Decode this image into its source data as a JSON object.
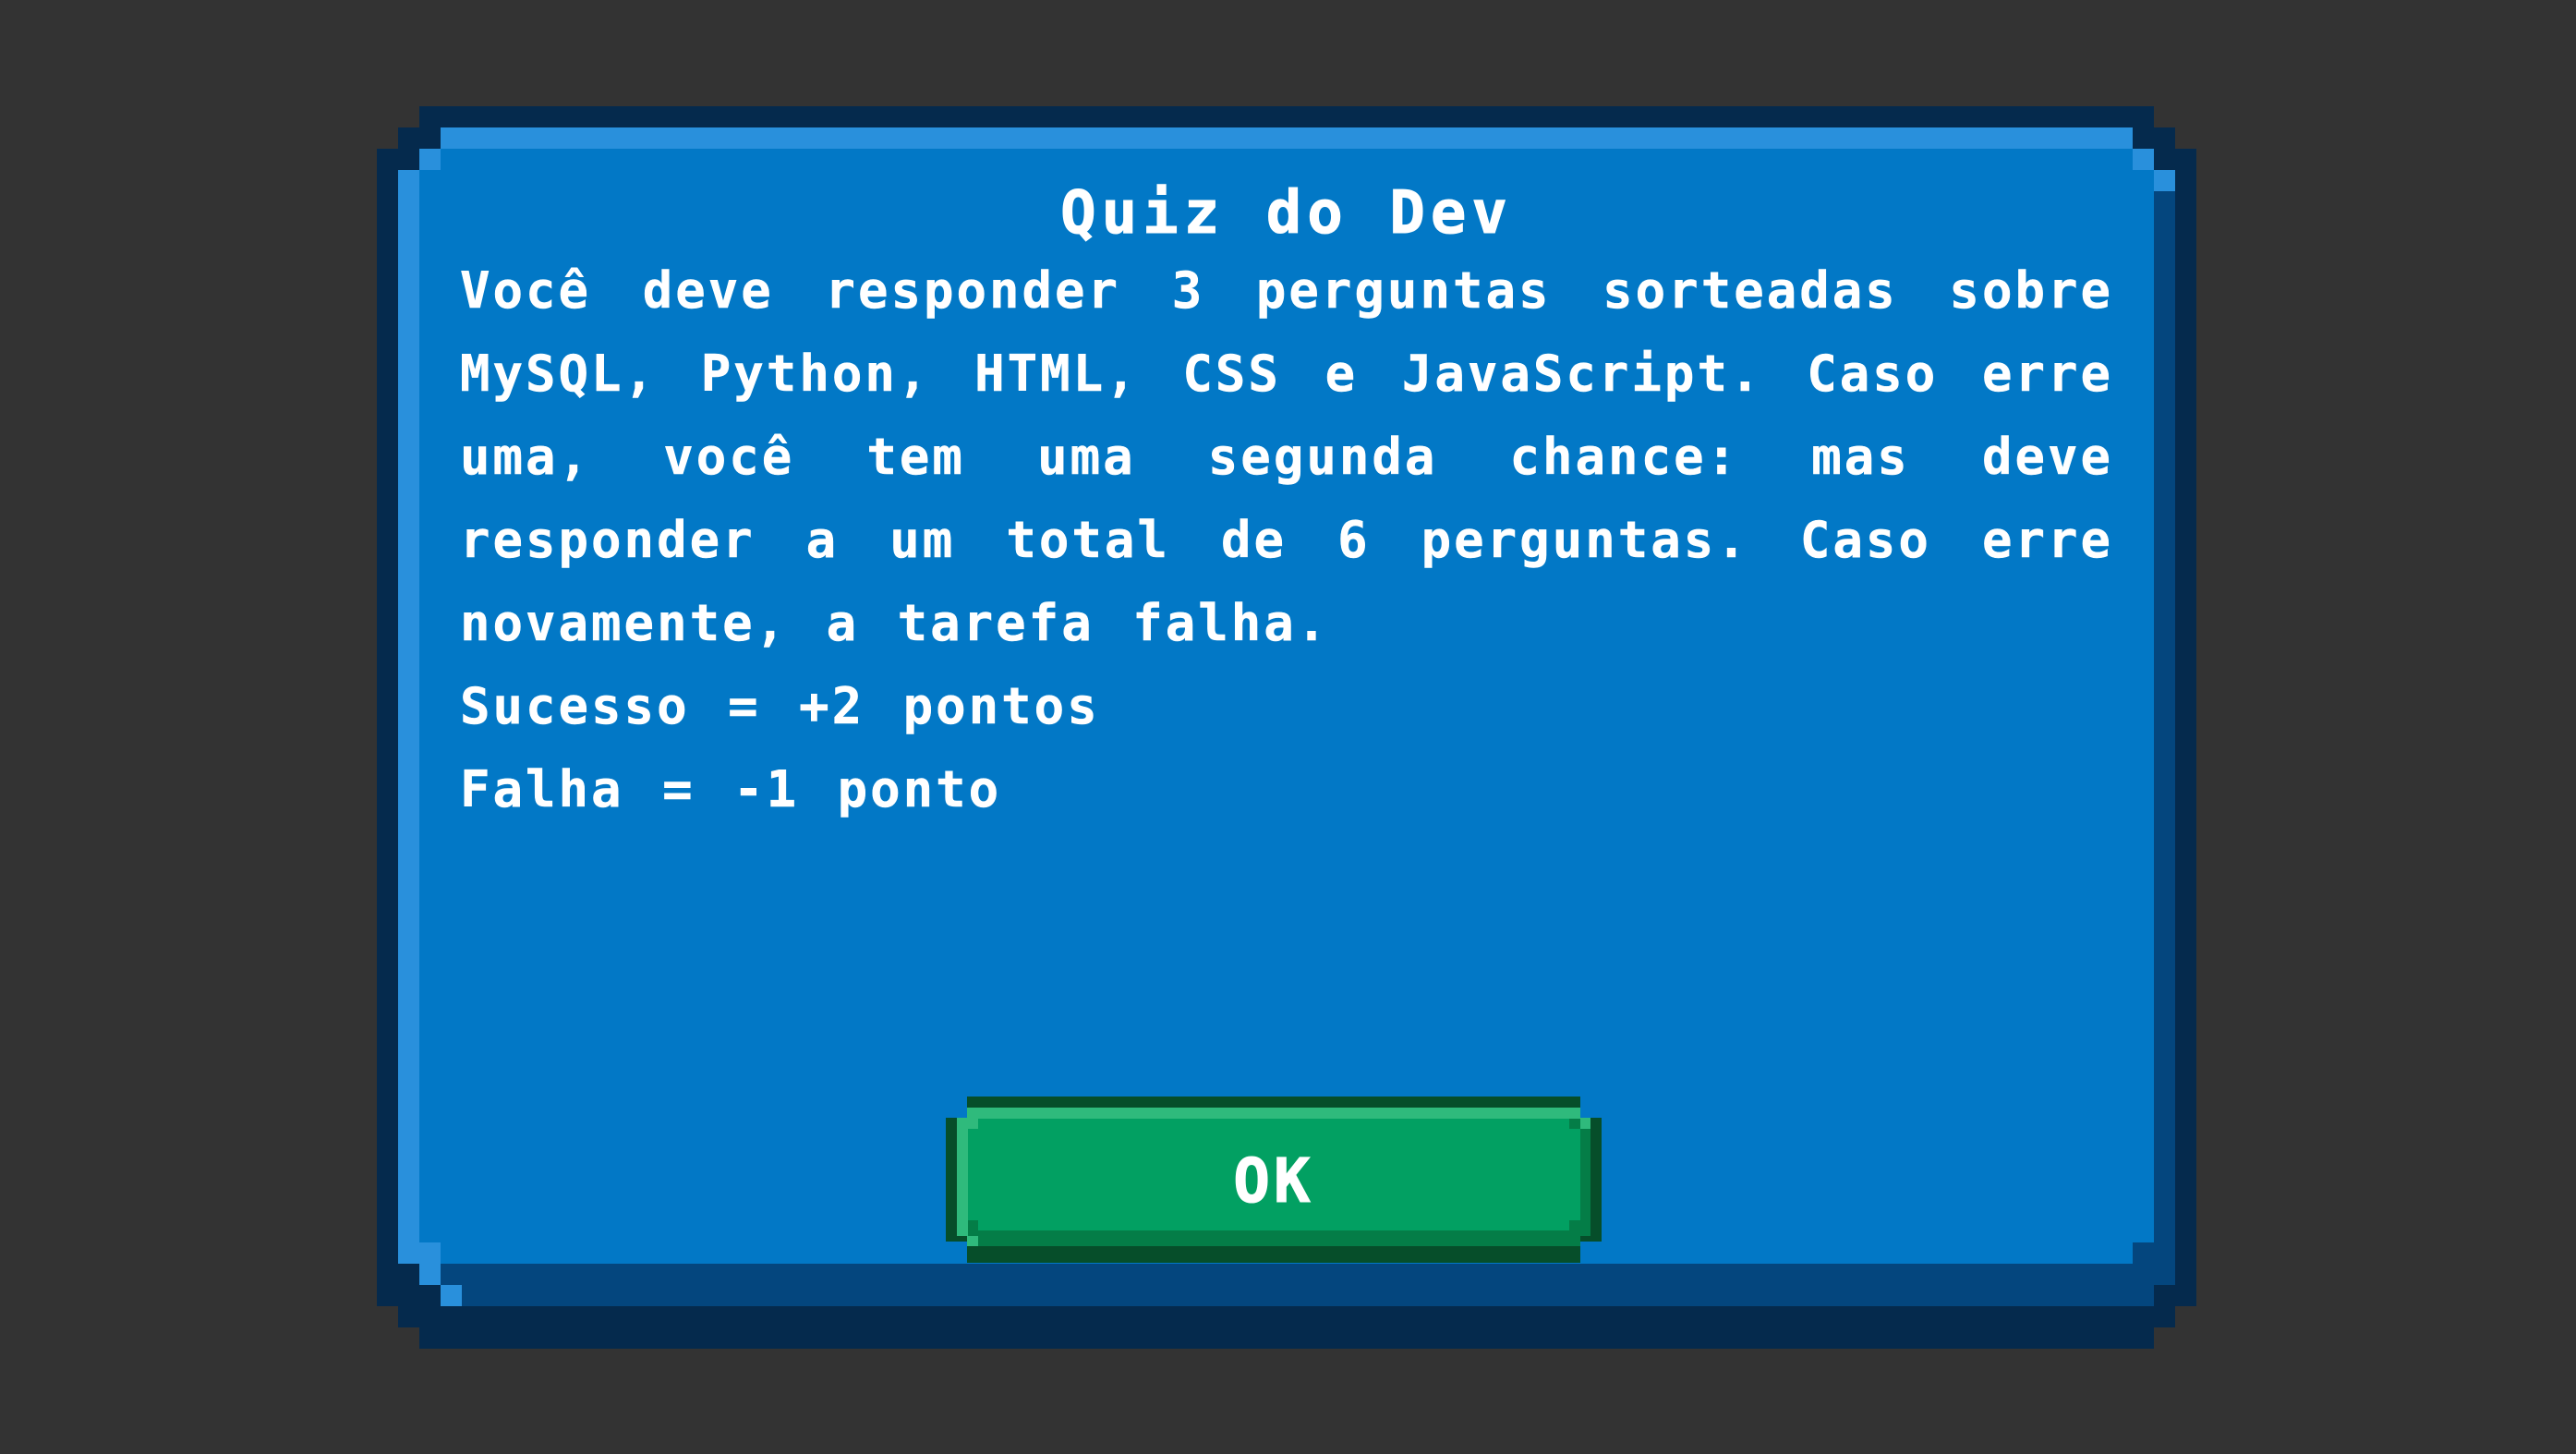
{
  "dialog": {
    "title": "Quiz do Dev",
    "paragraph": "Você deve responder 3 perguntas sorteadas sobre MySQL, Python, HTML, CSS e JavaScript. Caso erre uma, você tem uma segunda chance: mas deve responder a um total de 6 perguntas. Caso erre novamente, a tarefa falha.",
    "success_line": "Sucesso = +2 pontos",
    "failure_line": "Falha = -1 ponto",
    "ok_label": "OK"
  },
  "colors": {
    "background": "#333333",
    "dialog_fill": "#0278c6",
    "dialog_border": "#052a4d",
    "button_fill": "#02a062",
    "button_border": "#064e2a",
    "text": "#ffffff"
  }
}
